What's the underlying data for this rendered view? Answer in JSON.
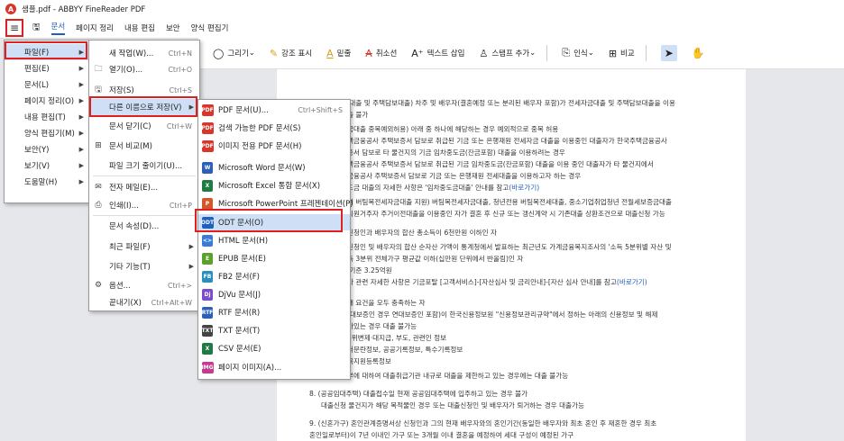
{
  "app": {
    "title": "샘플.pdf - ABBYY FineReader PDF"
  },
  "menubar": {
    "items": [
      "문서",
      "페이지 정리",
      "내용 편집",
      "보안",
      "양식 편집기"
    ]
  },
  "toolbar": {
    "items": [
      "그리기",
      "강조 표시",
      "밑줄",
      "취소선",
      "텍스트 삽입",
      "스탬프 추가",
      "인식",
      "비교"
    ]
  },
  "menu1": {
    "items": [
      {
        "label": "파일(F)"
      },
      {
        "label": "편집(E)"
      },
      {
        "label": "문서(L)"
      },
      {
        "label": "페이지 정리(O)"
      },
      {
        "label": "내용 편집(T)"
      },
      {
        "label": "양식 편집기(M)"
      },
      {
        "label": "보안(Y)"
      },
      {
        "label": "보기(V)"
      },
      {
        "label": "도움말(H)"
      }
    ]
  },
  "menu2": {
    "items": [
      {
        "label": "새 작업(W)...",
        "shortcut": "Ctrl+N"
      },
      {
        "label": "열기(O)...",
        "shortcut": "Ctrl+O"
      },
      {
        "label": "저장(S)",
        "shortcut": "Ctrl+S"
      },
      {
        "label": "다른 이름으로 저장(V)",
        "shortcut": ""
      },
      {
        "label": "문서 닫기(C)",
        "shortcut": "Ctrl+W"
      },
      {
        "label": "문서 비교(M)",
        "shortcut": ""
      },
      {
        "label": "파일 크기 줄이기(U)...",
        "shortcut": ""
      },
      {
        "label": "전자 메일(E)...",
        "shortcut": ""
      },
      {
        "label": "인쇄(I)...",
        "shortcut": "Ctrl+P"
      },
      {
        "label": "문서 속성(D)...",
        "shortcut": ""
      },
      {
        "label": "최근 파일(F)",
        "shortcut": ""
      },
      {
        "label": "기타 기능(T)",
        "shortcut": ""
      },
      {
        "label": "옵션...",
        "shortcut": "Ctrl+>"
      },
      {
        "label": "끝내기(X)",
        "shortcut": "Ctrl+Alt+W"
      }
    ]
  },
  "menu3": {
    "items": [
      {
        "label": "PDF 문서(U)...",
        "shortcut": "Ctrl+Shift+S",
        "color": "#d9362b",
        "tag": "PDF"
      },
      {
        "label": "검색 가능한 PDF 문서(S)",
        "shortcut": "",
        "color": "#d9362b",
        "tag": "PDF"
      },
      {
        "label": "이미지 전용 PDF 문서(H)",
        "shortcut": "",
        "color": "#d9362b",
        "tag": "PDF"
      },
      {
        "label": "Microsoft Word 문서(W)",
        "shortcut": "",
        "color": "#2b5fb8",
        "tag": "W"
      },
      {
        "label": "Microsoft Excel 통합 문서(X)",
        "shortcut": "",
        "color": "#1f7a44",
        "tag": "X"
      },
      {
        "label": "Microsoft PowerPoint 프레젠테이션(P)",
        "shortcut": "",
        "color": "#d2582a",
        "tag": "P"
      },
      {
        "label": "ODT 문서(O)",
        "shortcut": "",
        "color": "#1f5fbf",
        "tag": "ODT"
      },
      {
        "label": "HTML 문서(H)",
        "shortcut": "",
        "color": "#3a7bd5",
        "tag": "<>"
      },
      {
        "label": "EPUB 문서(E)",
        "shortcut": "",
        "color": "#5aa02c",
        "tag": "E"
      },
      {
        "label": "FB2 문서(F)",
        "shortcut": "",
        "color": "#2a8fbd",
        "tag": "FB"
      },
      {
        "label": "DjVu 문서(J)",
        "shortcut": "",
        "color": "#7c4cc9",
        "tag": "Dj"
      },
      {
        "label": "RTF 문서(R)",
        "shortcut": "",
        "color": "#2b5fb8",
        "tag": "RTF"
      },
      {
        "label": "TXT 문서(T)",
        "shortcut": "",
        "color": "#444444",
        "tag": "TXT"
      },
      {
        "label": "CSV 문서(E)",
        "shortcut": "",
        "color": "#1f7a44",
        "tag": "X"
      },
      {
        "label": "페이지 이미지(A)...",
        "shortcut": "",
        "color": "#c73a8e",
        "tag": "IMG"
      }
    ]
  },
  "doc": {
    "lines": [
      "이 자금대출 및 주택담보대출) 차주 및 배우자(결혼예정 또는 분리된 배우자 포함)가 전세자금대출 및 주택담보대출을 이용",
      "대출 불가",
      "도금대출 중복예외허용) 아래 중 하나에 해당하는 경우 예외적으로 중복 허용",
      "주택금융공사 주택보증서 담보로 취급된 기금 또는 은행재원 전세자금 대출을 이용중인 대출자가 한국주택금융공사",
      "보증서 담보로 타 물건지의 기금 임차중도금(잔금포함) 대출을 이용하려는 경우",
      "주택금융공사 주택보증서 담보로 취급된 기금 임차중도금(잔금포함) 대출을 이용 중인 대출자가 타 물건지에서",
      "택금융공사 주택보증서 담보로 기금 또는 은행재원 전세대출을 이용하고자 하는 경우",
      "중도금 대출의 자세한 사항은 '임차중도금대출' 안내를 참고(바로가기)",
      "기형 버팀목전세자금대출 지원) 버팀목전세자금대출, 청년전용 버팀목전세대출, 중소기업취업청년 전월세보증금대출",
      "고시원거주자 주거이전대출을 이용중인 자가 결혼 후 신규 또는 갱신계약 시 기존대출 상환조건으로 대출신청 가능",
      "출신청인과 배우자의 합산 총소득이 6천만원 이하인 자",
      "출신청인 및 배우자의 합산 순자산 가액이 통계청에서 발표하는 최근년도 가계금융복지조사의 '소득 5분위별 자산 및",
      "소득 3분위 전체가구 평균값 이하(십만원 단위에서 반올림)인 자",
      "도 기준 3.25억원",
      "심사 관련 자세한 사항은 기금포탈 [고객서비스]-[자산심사 및 금리안내]-[자산 심사 안내]를 참고(바로가기)",
      "아래 요건을 모두 충족하는 자",
      "(연대보증인 경우 연대보증인 포함)이 한국신용정보원 \"신용정보관리규약\"에서 정하는 아래의 신용정보 및 해제",
      "남아있는 경우 대출 불가능",
      ", 대위변제·대지급, 부도, 관련인 정보",
      "질서문란정보, 공공기록정보, 특수기록정보",
      "회복지원등록정보",
      "부부에 대하여 대출취급기관 내규로 대출을 제한하고 있는 경우에는 대출 불가능",
      "8. (공공임대주택) 대출접수일 현재 공공임대주택에 입주하고 있는 경우 불가",
      "대출신청 물건지가 해당 목적물인 경우 또는 대출신청인 및 배우자가 퇴거하는 경우 대출가능",
      "9. (신혼가구) 혼인관계증명서상 신청인과 그의 현재 배우자와의 혼인기간(동일한 배우자와 최초 혼인 후 재혼한 경우 최초",
      "혼인일로부터)이 7년 이내인 가구 또는 3개월 이내 결혼을 예정하여 세대 구성이 예정된 가구"
    ]
  }
}
